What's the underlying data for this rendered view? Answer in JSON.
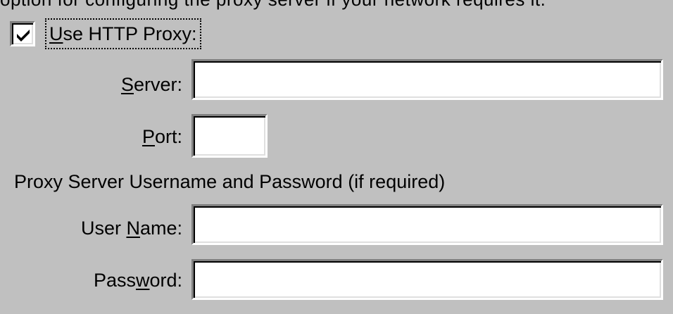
{
  "top_partial_text": "option for configuring the proxy server if your network requires it.",
  "proxy": {
    "use_http_proxy": {
      "checked": true,
      "label_prefix": "",
      "label_mnemonic": "U",
      "label_rest": "se HTTP Proxy:"
    },
    "server": {
      "label_prefix": "",
      "label_mnemonic": "S",
      "label_rest": "erver:",
      "value": "",
      "placeholder": ""
    },
    "port": {
      "label_prefix": "",
      "label_mnemonic": "P",
      "label_rest": "ort:",
      "value": "",
      "placeholder": ""
    }
  },
  "credentials": {
    "section_label": "Proxy Server Username and Password (if required)",
    "user_name": {
      "label_prefix": "User ",
      "label_mnemonic": "N",
      "label_rest": "ame:",
      "value": "",
      "placeholder": ""
    },
    "password": {
      "label_prefix": "Pass",
      "label_mnemonic": "w",
      "label_rest": "ord:",
      "value": "",
      "placeholder": ""
    }
  },
  "colors": {
    "dialog_background": "#c0c0c0",
    "field_background": "#ffffff",
    "text": "#000000"
  },
  "icons": {
    "checkbox_mark": "check-mark-icon"
  }
}
